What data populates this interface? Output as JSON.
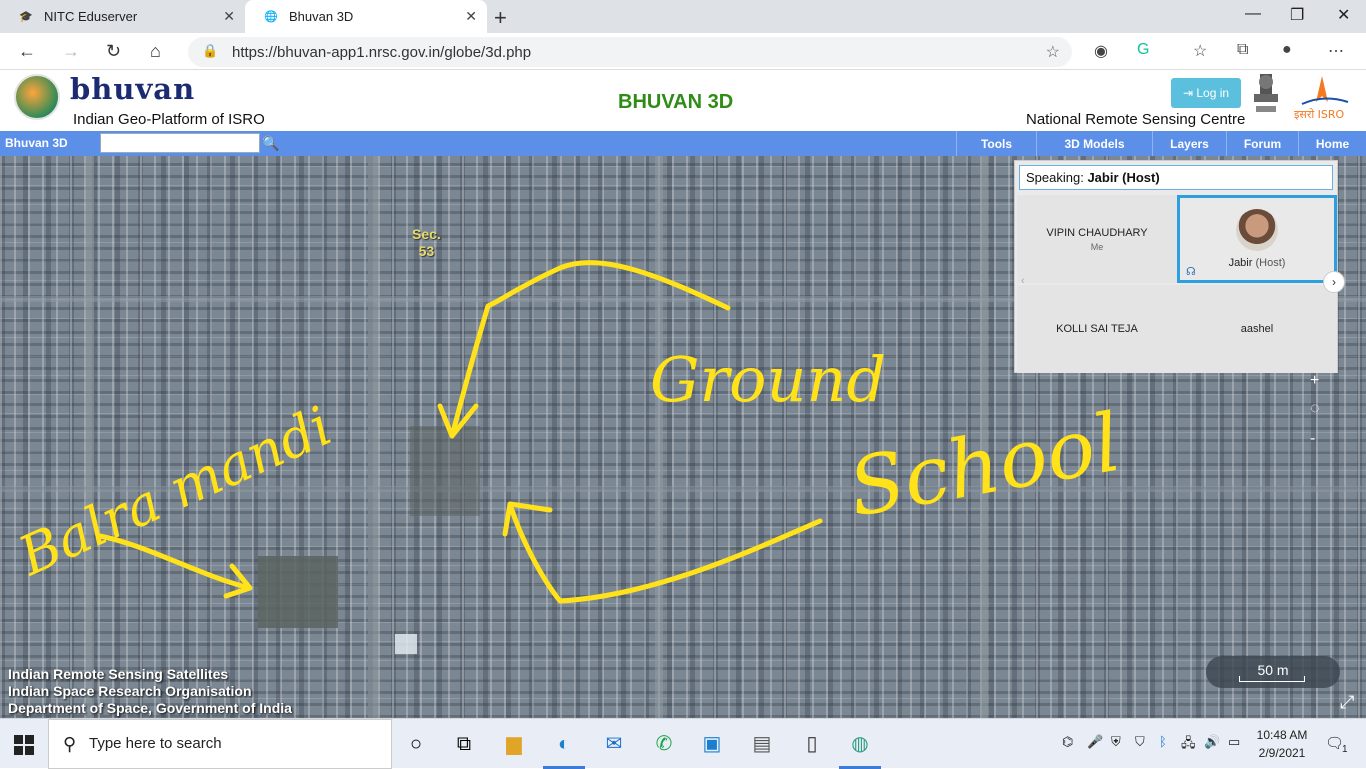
{
  "browser": {
    "tabs": [
      {
        "title": "NITC Eduserver",
        "active": false
      },
      {
        "title": "Bhuvan 3D",
        "active": true
      }
    ],
    "url": "https://bhuvan-app1.nrsc.gov.in/globe/3d.php"
  },
  "header": {
    "logo_text": "bhuvan",
    "tagline": "Indian Geo-Platform of ISRO",
    "title": "BHUVAN 3D",
    "login_label": "Log in",
    "org": "National Remote Sensing Centre",
    "isro_text": "इसरो ISRO"
  },
  "menu": {
    "brand": "Bhuvan 3D",
    "search_value": "",
    "items": [
      "Tools",
      "3D Models",
      "Layers",
      "Forum",
      "Home"
    ]
  },
  "map": {
    "sector_label_line1": "Sec.",
    "sector_label_line2": "53",
    "credits": [
      "Indian Remote Sensing Satellites",
      "Indian Space Research Organisation",
      "Department of Space, Government of India"
    ],
    "scale_label": "50 m",
    "annotation_color": "#ffe21a",
    "annotations": [
      "Ground",
      "School",
      "Balra mandi"
    ]
  },
  "meeting": {
    "speaking_label": "Speaking:",
    "speaking_name": "Jabir (Host)",
    "participants": [
      {
        "name": "VIPIN CHAUDHARY",
        "sub": "Me"
      },
      {
        "name": "Jabir",
        "sub": "(Host)"
      },
      {
        "name": "KOLLI SAI TEJA",
        "sub": ""
      },
      {
        "name": "aashel",
        "sub": ""
      }
    ]
  },
  "taskbar": {
    "search_placeholder": "Type here to search",
    "time": "10:48 AM",
    "date": "2/9/2021",
    "notification_count": "1"
  }
}
